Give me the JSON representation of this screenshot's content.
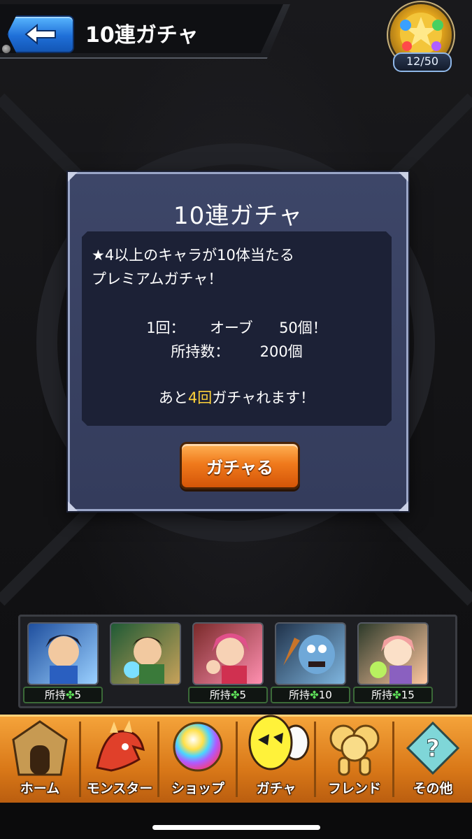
{
  "header": {
    "title": "10連ガチャ"
  },
  "stamina": {
    "count": "12/50"
  },
  "dialog": {
    "title": "10連ガチャ",
    "description_line1": "★4以上のキャラが10体当たる",
    "description_line2": "プレミアムガチャ！",
    "cost_label": "1回：",
    "cost_item": "オーブ",
    "cost_value": "50個！",
    "owned_label": "所持数：",
    "owned_value": "200個",
    "remaining_prefix": "あと",
    "remaining_count": "4回",
    "remaining_suffix": "ガチャれます！",
    "button_label": "ガチャる"
  },
  "party": {
    "slots": [
      {
        "owned_label": "所持",
        "owned_count": "5",
        "colors": [
          "#1f4f9e",
          "#9ad0ff"
        ]
      },
      {
        "colors": [
          "#1f5a35",
          "#c7a25a"
        ]
      },
      {
        "owned_label": "所持",
        "owned_count": "5",
        "colors": [
          "#7a2a2a",
          "#ff8fb0"
        ]
      },
      {
        "owned_label": "所持",
        "owned_count": "10",
        "colors": [
          "#20324a",
          "#7fb6e0"
        ]
      },
      {
        "owned_label": "所持",
        "owned_count": "15",
        "colors": [
          "#2d3a2a",
          "#ffc7a0"
        ]
      }
    ]
  },
  "nav": {
    "items": [
      {
        "label": "ホーム",
        "icon": "home-icon"
      },
      {
        "label": "モンスター",
        "icon": "monster-icon"
      },
      {
        "label": "ショップ",
        "icon": "shop-orb-icon"
      },
      {
        "label": "ガチャ",
        "icon": "gacha-egg-icon"
      },
      {
        "label": "フレンド",
        "icon": "friend-balloons-icon"
      },
      {
        "label": "その他",
        "icon": "other-icon"
      }
    ]
  }
}
